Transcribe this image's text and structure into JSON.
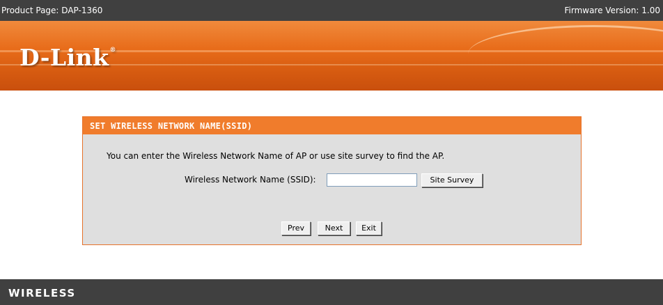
{
  "header": {
    "product_page": "Product Page: DAP-1360",
    "firmware_version": "Firmware Version: 1.00"
  },
  "brand": {
    "logo_text": "D-Link",
    "logo_mark": "®",
    "banner_color": "#e86c1a"
  },
  "wizard": {
    "title": "SET WIRELESS NETWORK NAME(SSID)",
    "instruction": "You can enter the Wireless Network Name of AP or use site survey to find the AP.",
    "ssid_label": "Wireless Network Name (SSID):",
    "ssid_value": "",
    "site_survey_label": "Site Survey",
    "prev_label": "Prev",
    "next_label": "Next",
    "exit_label": "Exit",
    "header_color": "#f07c2c"
  },
  "footer": {
    "label": "WIRELESS"
  }
}
